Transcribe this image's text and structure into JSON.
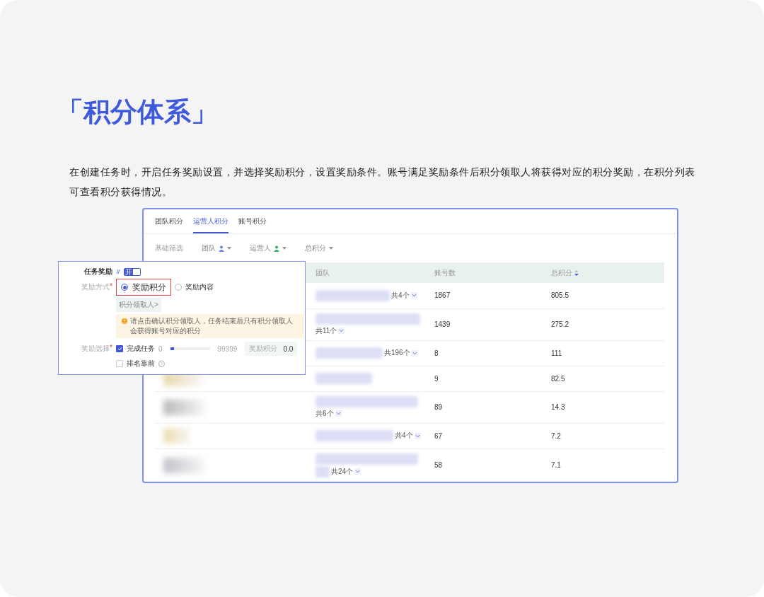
{
  "heading": "「积分体系」",
  "description": "在创建任务时，开启任务奖励设置，并选择奖励积分，设置奖励条件。账号满足奖励条件后积分领取人将获得对应的积分奖励，在积分列表可查看积分获得情况。",
  "tabs": [
    {
      "label": "团队积分",
      "selected": false
    },
    {
      "label": "运营人积分",
      "selected": true
    },
    {
      "label": "账号积分",
      "selected": false
    }
  ],
  "filters": {
    "label": "基础筛选",
    "items": [
      {
        "label": "团队",
        "kind": "team"
      },
      {
        "label": "运营人",
        "kind": "operator"
      },
      {
        "label": "总积分",
        "kind": "plain"
      }
    ]
  },
  "table": {
    "columns": [
      {
        "label": "团队",
        "sortable": false
      },
      {
        "label": "账号数",
        "sortable": false
      },
      {
        "label": "总积分",
        "sortable": true
      }
    ],
    "rows": [
      {
        "count": "共4个",
        "accounts": "1867",
        "points": "805.5"
      },
      {
        "count": "共11个",
        "accounts": "1439",
        "points": "275.2"
      },
      {
        "count": "共196个",
        "accounts": "8",
        "points": "111"
      },
      {
        "accounts": "9",
        "points": "82.5"
      },
      {
        "count": "共6个",
        "accounts": "89",
        "points": "14.3"
      },
      {
        "count": "共4个",
        "accounts": "67",
        "points": "7.2"
      },
      {
        "count": "共24个",
        "accounts": "58",
        "points": "7.1"
      }
    ]
  },
  "reward_form": {
    "title": "任务奖励",
    "toggle": {
      "label": "开",
      "on": true
    },
    "method": {
      "label": "奖励方式",
      "required_mark": "*",
      "options": [
        {
          "label": "奖励积分",
          "selected": true
        },
        {
          "label": "奖励内容",
          "selected": false
        }
      ]
    },
    "receiver_tag": "积分领取人>",
    "warning": "请点击确认积分领取人，任务结束后只有积分领取人会获得账号对应的积分",
    "choice": {
      "label": "奖励选择",
      "required_mark": "*",
      "options": [
        {
          "kind": "range",
          "label": "完成任务",
          "checked": true,
          "min": "0",
          "max": "99999",
          "level": 0.05,
          "field_label": "奖励积分",
          "field_value": "0.0"
        },
        {
          "kind": "help",
          "label": "排名靠前",
          "checked": false
        }
      ]
    }
  }
}
